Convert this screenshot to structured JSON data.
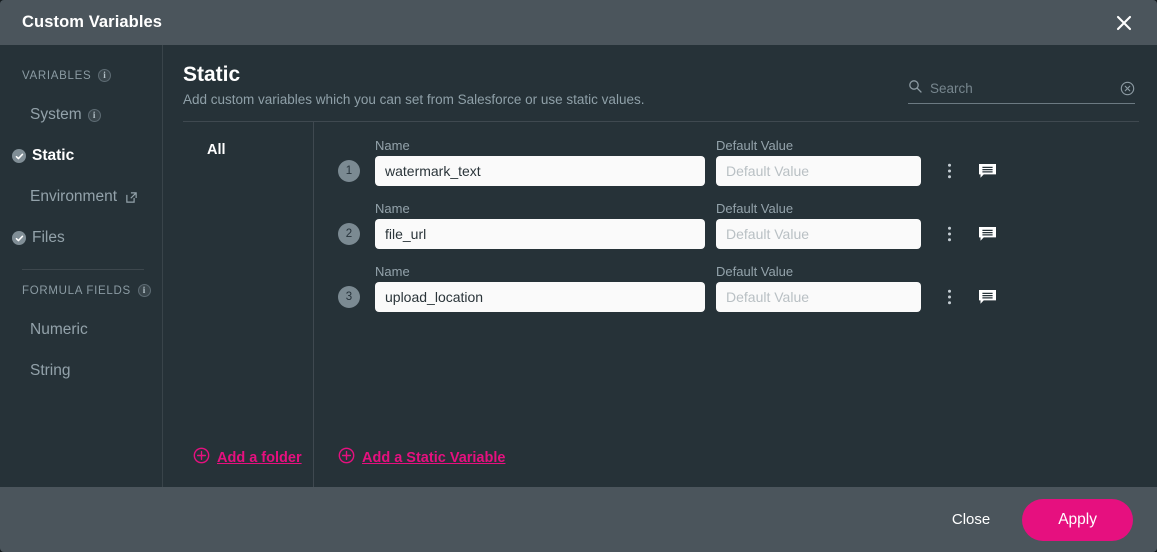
{
  "window": {
    "title": "Custom Variables",
    "close_icon": "close-icon"
  },
  "sidebar": {
    "groups": [
      {
        "label": "VARIABLES",
        "has_info": true,
        "items": [
          {
            "label": "System",
            "icon": "info-icon",
            "selected": false
          },
          {
            "label": "Static",
            "icon": "check-circle-icon",
            "selected": true
          },
          {
            "label": "Environment",
            "icon": "external-link-icon",
            "selected": false
          },
          {
            "label": "Files",
            "icon": "check-circle-icon",
            "selected": false
          }
        ]
      },
      {
        "label": "FORMULA FIELDS",
        "has_info": true,
        "items": [
          {
            "label": "Numeric",
            "icon": "",
            "selected": false
          },
          {
            "label": "String",
            "icon": "",
            "selected": false
          }
        ]
      }
    ]
  },
  "main": {
    "title": "Static",
    "subtitle": "Add custom variables which you can set from Salesforce or use static values.",
    "search": {
      "placeholder": "Search",
      "value": "",
      "search_icon": "search-icon",
      "clear_icon": "clear-circle-icon"
    },
    "folders": {
      "items": [
        "All"
      ],
      "add_folder_label": "Add a folder",
      "add_folder_icon": "plus-circle-icon"
    },
    "columns": {
      "name": "Name",
      "default_value": "Default Value"
    },
    "rows": [
      {
        "number": "1",
        "name": "watermark_text",
        "default_value": "",
        "default_placeholder": "Default Value",
        "menu_icon": "kebab-menu-icon",
        "comment_icon": "comment-icon"
      },
      {
        "number": "2",
        "name": "file_url",
        "default_value": "",
        "default_placeholder": "Default Value",
        "menu_icon": "kebab-menu-icon",
        "comment_icon": "comment-icon"
      },
      {
        "number": "3",
        "name": "upload_location",
        "default_value": "",
        "default_placeholder": "Default Value",
        "menu_icon": "kebab-menu-icon",
        "comment_icon": "comment-icon"
      }
    ],
    "add_variable_label": "Add a Static Variable",
    "add_variable_icon": "plus-circle-icon"
  },
  "footer": {
    "close_label": "Close",
    "apply_label": "Apply"
  },
  "colors": {
    "accent": "#e6107f",
    "titlebar": "#4b555c",
    "panel": "#263238",
    "input_bg": "#fafafa"
  }
}
